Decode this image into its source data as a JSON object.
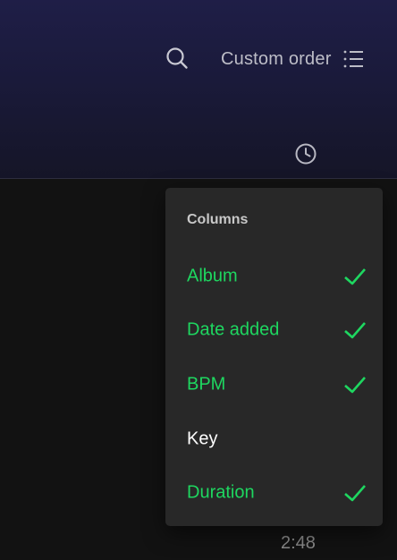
{
  "toolbar": {
    "search_icon": "search-icon",
    "sort_label": "Custom order",
    "sort_icon": "list-icon"
  },
  "table_header": {
    "duration_icon": "clock-icon"
  },
  "menu": {
    "heading": "Columns",
    "items": [
      {
        "label": "Album",
        "checked": true
      },
      {
        "label": "Date added",
        "checked": true
      },
      {
        "label": "BPM",
        "checked": true
      },
      {
        "label": "Key",
        "checked": false
      },
      {
        "label": "Duration",
        "checked": true
      }
    ]
  },
  "rows": {
    "visible_duration": "2:48"
  },
  "colors": {
    "accent": "#1ed760",
    "menu_bg": "#282828",
    "page_bg": "#121212",
    "header_gradient_top": "#1f1e47"
  }
}
